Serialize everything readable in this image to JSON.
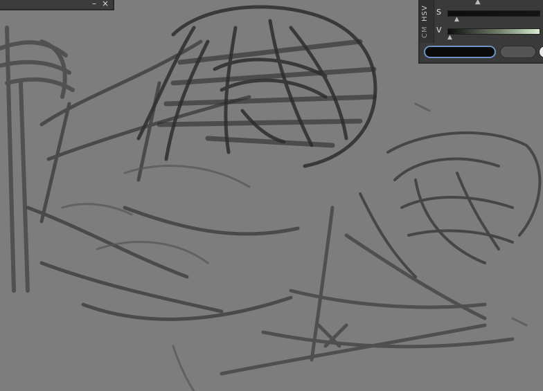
{
  "mini_panel": {
    "minimize_glyph": "–",
    "close_glyph": "×"
  },
  "color_panel": {
    "tabs": [
      "HSV",
      "CM"
    ],
    "sliders": [
      {
        "label": "S",
        "track_colors": [
          "#0e0e0e",
          "#141414"
        ]
      },
      {
        "label": "V",
        "track_colors": [
          "#0d0d0d",
          "#6f7d69",
          "#d7ecd2"
        ]
      }
    ],
    "swatches": {
      "main_color": "#0b0b0b",
      "sub_color": "#555555",
      "focus_border": "#6f93c9"
    },
    "icons": [
      "caret-up-icon",
      "slider-caret-icon",
      "color-wheel-icon"
    ]
  },
  "canvas": {
    "background": "#7d7d7d",
    "stroke_dark": "#3a3a3a",
    "stroke_mid": "#4d4d4d"
  }
}
